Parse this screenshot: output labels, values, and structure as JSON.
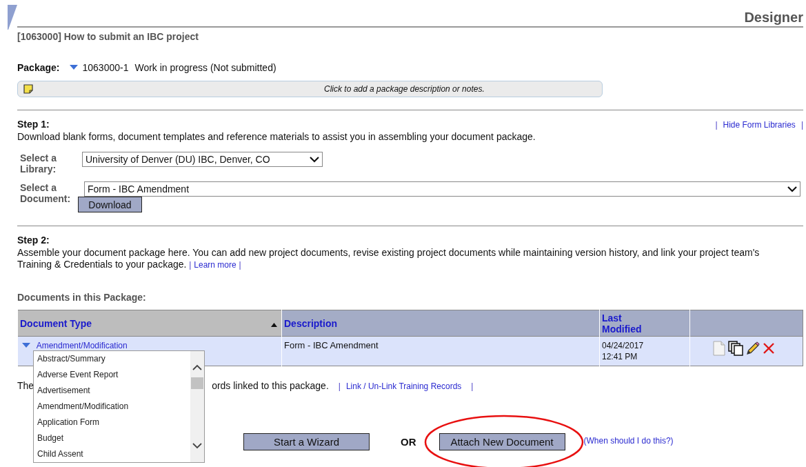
{
  "header": {
    "title": "Designer"
  },
  "project_title": "[1063000] How to submit an IBC project",
  "package": {
    "label": "Package:",
    "expanded": true,
    "id": "1063000-1",
    "status": "Work in progress (Not submitted)"
  },
  "notes_bar": {
    "prompt": "Click to add a package description or notes."
  },
  "step1": {
    "heading": "Step 1:",
    "hide_link": {
      "pre": "|",
      "label": "Hide Form Libraries",
      "post": "|"
    },
    "text": "Download blank forms, document templates and reference materials to assist you in assembling your document package.",
    "library": {
      "label": "Select a Library:",
      "value": "University of Denver (DU) IBC, Denver, CO"
    },
    "document": {
      "label": "Select a Document:",
      "value": "Form - IBC Amendment"
    },
    "download_button": "Download"
  },
  "step2": {
    "heading": "Step 2:",
    "text": "Assemble your document package here. You can add new project documents, revise existing project documents while maintaining version history, and link your project team's Training & Credentials to your package.",
    "learn_more": {
      "pre": "|",
      "label": "Learn more",
      "post": "|"
    }
  },
  "documents_heading": "Documents in this Package:",
  "table": {
    "columns": [
      {
        "label": "Document Type",
        "sorted": true
      },
      {
        "label": "Description",
        "sorted": false
      },
      {
        "label": "Last Modified",
        "sorted": false
      }
    ],
    "rows": [
      {
        "type": "Amendment/Modification",
        "expanded": true,
        "description": "Form - IBC Amendment",
        "modified_date": "04/24/2017",
        "modified_time": "12:41 PM"
      }
    ]
  },
  "type_dropdown": {
    "options": [
      "Abstract/Summary",
      "Adverse Event Report",
      "Advertisement",
      "Amendment/Modification",
      "Application Form",
      "Budget",
      "Child Assent"
    ]
  },
  "training": {
    "text_start": "The",
    "text_end": "ords linked to this package.",
    "link": {
      "pre": "|",
      "label": "Link / Un-Link Training Records",
      "post": "|"
    }
  },
  "actions": {
    "wizard_button": "Start a Wizard",
    "or": "OR",
    "attach_button": {
      "label": "Attach New Document",
      "circled": true
    },
    "help_link": "(When should I do this?)"
  }
}
